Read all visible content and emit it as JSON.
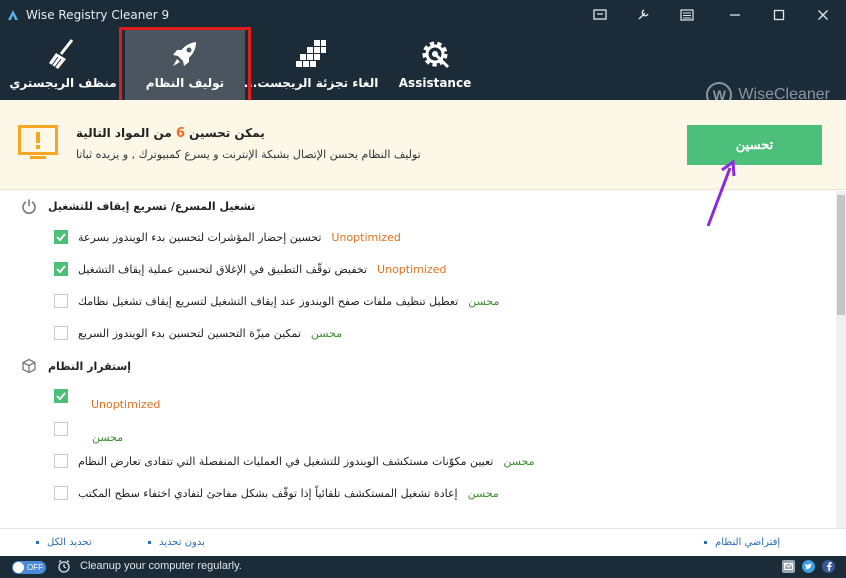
{
  "window": {
    "title": "Wise Registry Cleaner 9"
  },
  "toolbar": {
    "tools": [
      {
        "label": "منظف الريجستري",
        "icon": "broom-icon"
      },
      {
        "label": "توليف النظام",
        "icon": "rocket-icon"
      },
      {
        "label": "...الغاء تجزئة الريجست",
        "icon": "defrag-blocks-icon"
      },
      {
        "label": "Assistance",
        "icon": "gear-wrench-icon"
      }
    ],
    "active_index": 1,
    "brand": "WiseCleaner",
    "brand_letter": "W"
  },
  "banner": {
    "title_prefix": "يمكن تحسين",
    "count": "6",
    "title_suffix": "من المواد التالية",
    "subtitle": "توليف النظام يحسن الإتصال بشبكة الإنترنت و يسرع كمبيوترك , و يزيده ثباتا",
    "optimize_label": "تحسين"
  },
  "sections": [
    {
      "title": "تشغيل المسرع/ تسريع إيقاف للتشغيل",
      "icon": "power-icon",
      "items": [
        {
          "text": "تحسين إحضار المؤشرات لتحسين بدء الويندوز بسرعة",
          "status": "Unoptimized",
          "checked": true
        },
        {
          "text": "تخفيض توقّف التطبيق في الإغلاق لتحسين عملية إيقاف التشغيل",
          "status": "Unoptimized",
          "checked": true
        },
        {
          "text": "تعطيل تنظيف ملفات صفح الويندوز عند إيقاف التشغيل لتسريع  إيقاف تشغيل نظامك",
          "status": "محسن",
          "checked": false
        },
        {
          "text": "تمكين ميزّة التحسين لتحسين بدء الويندوز السريع",
          "status": "محسن",
          "checked": false
        }
      ]
    },
    {
      "title": "إستقرار النظام",
      "icon": "cube-icon",
      "items": [
        {
          "text": "",
          "status": "Unoptimized",
          "checked": true
        },
        {
          "text": "",
          "status": "محسن",
          "checked": false
        },
        {
          "text": "تعيين مكوّنات مستكشف الويندوز للتشغيل في العمليات المنفصلة التي تتفادى تعارض النظام",
          "status": "محسن",
          "checked": false
        },
        {
          "text": "إعادة تشغيل المستكشف تلقائياً إذا توقّف بشكل مفاجئ لتفادي اختفاء سطح المكتب",
          "status": "محسن",
          "checked": false
        }
      ]
    }
  ],
  "footer": {
    "select_all": "تحديد الكل",
    "select_none": "بدون تحديد",
    "system_default": "إفتراضي النظام"
  },
  "statusbar": {
    "toggle_label": "OFF",
    "message": "Cleanup your computer regularly."
  },
  "colors": {
    "dark_bg": "#1c2b38",
    "accent_green": "#4cc07a",
    "unoptimized": "#e2701e",
    "optimized": "#3c8f2e",
    "highlight_red": "#e21b1b"
  }
}
